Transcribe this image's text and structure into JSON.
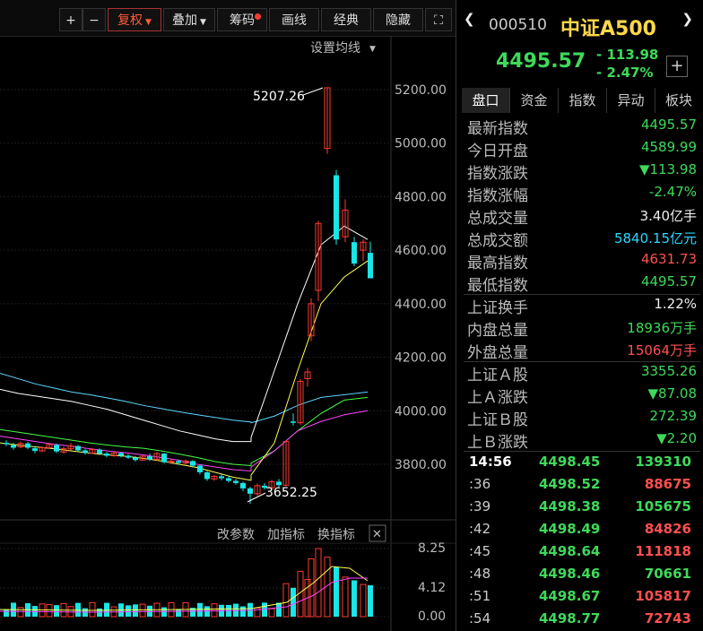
{
  "toolbar": {
    "plus": "+",
    "minus": "−",
    "fuquan": "复权",
    "diejia": "叠加",
    "chouma": "筹码",
    "huaxian": "画线",
    "jingdian": "经典",
    "yincang": "隐藏",
    "fullscreen": "⛶"
  },
  "chart": {
    "ma_settings": "设置均线",
    "high_marker": "5207.26",
    "low_marker": "3652.25",
    "price_ticks": [
      "5200.00",
      "5000.00",
      "4800.00",
      "4600.00",
      "4400.00",
      "4200.00",
      "4000.00",
      "3800.00"
    ],
    "indicator_buttons": [
      "改参数",
      "加指标",
      "换指标"
    ],
    "indicator_close": "✕",
    "vol_ticks": [
      "8.25",
      "4.12",
      "0.00"
    ],
    "colors": {
      "up": "#ff3b30",
      "down": "#19e6e6",
      "ma1": "#ffffff",
      "ma2": "#ffff55",
      "ma3": "#ff44ff",
      "ma4": "#44ff44",
      "ma5": "#5bd7ff"
    }
  },
  "panel": {
    "code": "000510",
    "name": "中证A500",
    "price": "4495.57",
    "change": "- 113.98",
    "change_pct": "- 2.47%",
    "add_icon": "+",
    "tabs": [
      "盘口",
      "资金",
      "指数",
      "异动",
      "板块"
    ],
    "stats": [
      {
        "label": "最新指数",
        "value": "4495.57",
        "color": "green"
      },
      {
        "label": "今日开盘",
        "value": "4589.99",
        "color": "green"
      },
      {
        "label": "指数涨跌",
        "value": "▼113.98",
        "color": "green"
      },
      {
        "label": "指数涨幅",
        "value": "-2.47%",
        "color": "green"
      },
      {
        "label": "总成交量",
        "value": "3.40亿手",
        "color": "white"
      },
      {
        "label": "总成交额",
        "value": "5840.15亿元",
        "color": "cyan"
      },
      {
        "label": "最高指数",
        "value": "4631.73",
        "color": "red2"
      },
      {
        "label": "最低指数",
        "value": "4495.57",
        "color": "green"
      }
    ],
    "stats2": [
      {
        "label": "上证换手",
        "value": "1.22%",
        "color": "white"
      },
      {
        "label": "内盘总量",
        "value": "18936万手",
        "color": "green"
      },
      {
        "label": "外盘总量",
        "value": "15064万手",
        "color": "red2"
      }
    ],
    "stats3": [
      {
        "label": "上证Ａ股",
        "value": "3355.26",
        "color": "green"
      },
      {
        "label": "上Ａ涨跌",
        "value": "▼87.08",
        "color": "green"
      },
      {
        "label": "上证Ｂ股",
        "value": "272.39",
        "color": "green"
      },
      {
        "label": "上Ｂ涨跌",
        "value": "▼2.20",
        "color": "green"
      }
    ],
    "trades": [
      {
        "time": "14:56",
        "price": "4498.45",
        "vol": "139310",
        "vc": "green"
      },
      {
        "time": ":36",
        "price": "4498.52",
        "vol": "88675",
        "vc": "red2"
      },
      {
        "time": ":39",
        "price": "4498.38",
        "vol": "105675",
        "vc": "green"
      },
      {
        "time": ":42",
        "price": "4498.49",
        "vol": "84826",
        "vc": "red2"
      },
      {
        "time": ":45",
        "price": "4498.64",
        "vol": "111818",
        "vc": "red2"
      },
      {
        "time": ":48",
        "price": "4498.46",
        "vol": "70661",
        "vc": "green"
      },
      {
        "time": ":51",
        "price": "4498.67",
        "vol": "105817",
        "vc": "red2"
      },
      {
        "time": ":54",
        "price": "4498.77",
        "vol": "72743",
        "vc": "red2"
      }
    ]
  }
}
